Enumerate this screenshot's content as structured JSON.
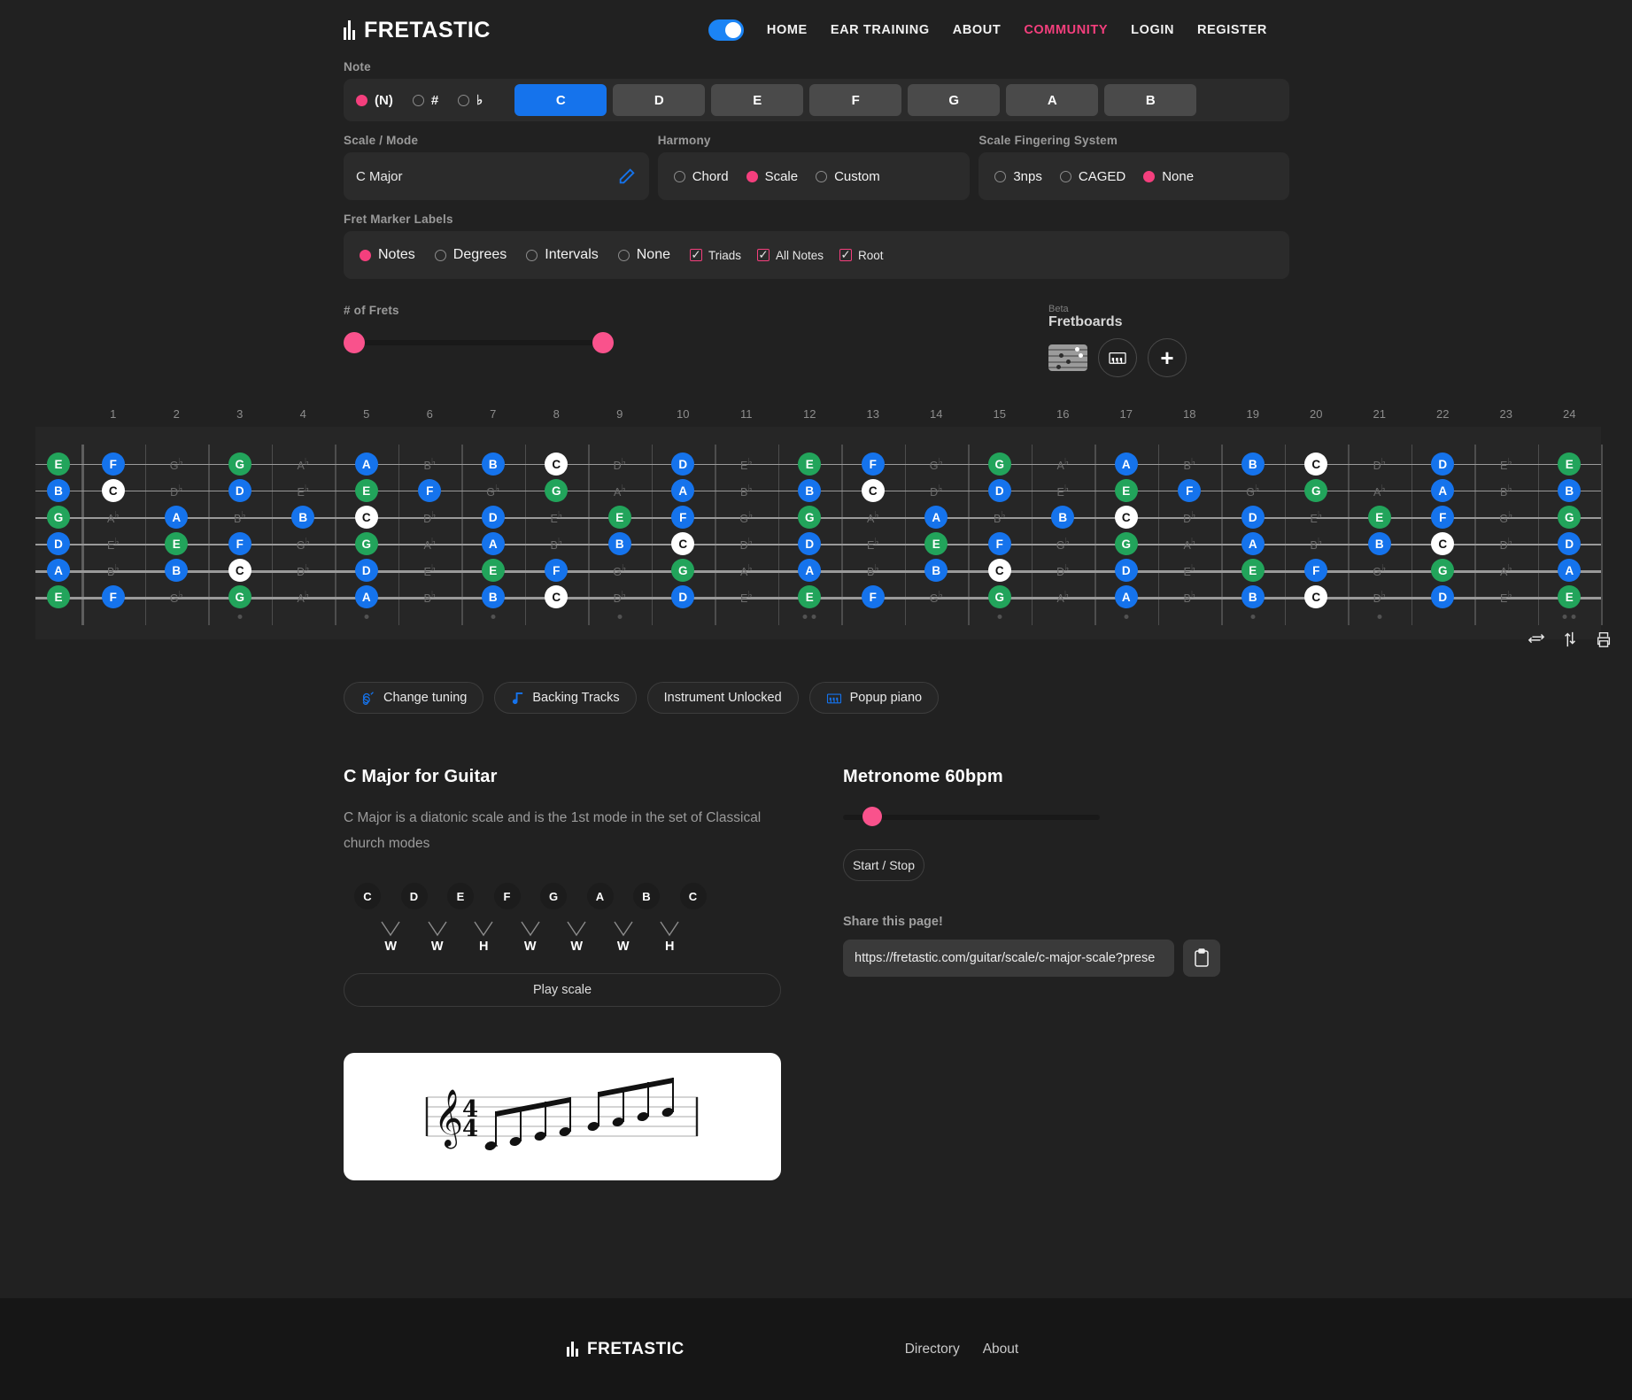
{
  "header": {
    "brand": "FRETASTIC",
    "toggle_state": "on",
    "nav": [
      {
        "label": "HOME",
        "active": false
      },
      {
        "label": "EAR TRAINING",
        "active": false
      },
      {
        "label": "ABOUT",
        "active": false
      },
      {
        "label": "COMMUNITY",
        "active": true
      },
      {
        "label": "LOGIN",
        "active": false
      },
      {
        "label": "REGISTER",
        "active": false
      }
    ]
  },
  "note_section": {
    "label": "Note",
    "accidentals": [
      {
        "label": "(N)",
        "selected": true
      },
      {
        "label": "#",
        "selected": false
      },
      {
        "label": "♭",
        "selected": false
      }
    ],
    "notes": [
      {
        "label": "C",
        "selected": true
      },
      {
        "label": "D",
        "selected": false
      },
      {
        "label": "E",
        "selected": false
      },
      {
        "label": "F",
        "selected": false
      },
      {
        "label": "G",
        "selected": false
      },
      {
        "label": "A",
        "selected": false
      },
      {
        "label": "B",
        "selected": false
      }
    ]
  },
  "scale_mode": {
    "label": "Scale / Mode",
    "value": "C Major",
    "edit_icon": "pencil-icon"
  },
  "harmony": {
    "label": "Harmony",
    "options": [
      {
        "label": "Chord",
        "selected": false
      },
      {
        "label": "Scale",
        "selected": true
      },
      {
        "label": "Custom",
        "selected": false
      }
    ]
  },
  "fingering": {
    "label": "Scale Fingering System",
    "options": [
      {
        "label": "3nps",
        "selected": false
      },
      {
        "label": "CAGED",
        "selected": false
      },
      {
        "label": "None",
        "selected": true
      }
    ]
  },
  "fret_marker_labels": {
    "label": "Fret Marker Labels",
    "radios": [
      {
        "label": "Notes",
        "selected": true
      },
      {
        "label": "Degrees",
        "selected": false
      },
      {
        "label": "Intervals",
        "selected": false
      },
      {
        "label": "None",
        "selected": false
      }
    ],
    "checkboxes": [
      {
        "label": "Triads",
        "checked": true
      },
      {
        "label": "All Notes",
        "checked": true
      },
      {
        "label": "Root",
        "checked": true
      }
    ]
  },
  "frets_slider": {
    "label": "# of Frets",
    "min_value": 0,
    "max_value": 24
  },
  "fretboards": {
    "beta": "Beta",
    "title": "Fretboards",
    "items": [
      "fretboard-thumb-icon",
      "piano-icon",
      "plus-icon"
    ]
  },
  "fretboard": {
    "fret_numbers": [
      1,
      2,
      3,
      4,
      5,
      6,
      7,
      8,
      9,
      10,
      11,
      12,
      13,
      14,
      15,
      16,
      17,
      18,
      19,
      20,
      21,
      22,
      23,
      24
    ],
    "open_strings": [
      "E",
      "B",
      "G",
      "D",
      "A",
      "E"
    ],
    "inlay_frets": [
      3,
      5,
      7,
      9,
      12,
      15,
      17,
      19,
      21,
      24
    ],
    "root_note": "C",
    "scale_notes": [
      "C",
      "D",
      "E",
      "F",
      "G",
      "A",
      "B"
    ],
    "color_legend": {
      "root": "#ffffff",
      "triad": "#22a45b",
      "scale": "#1573ec",
      "non_scale": "#6b6b6b"
    },
    "strings": [
      {
        "open": "E",
        "notes": [
          "F",
          "G♭",
          "G",
          "A♭",
          "A",
          "B♭",
          "B",
          "C",
          "D♭",
          "D",
          "E♭",
          "E",
          "F",
          "G♭",
          "G",
          "A♭",
          "A",
          "B♭",
          "B",
          "C",
          "D♭",
          "D",
          "E♭",
          "E"
        ]
      },
      {
        "open": "B",
        "notes": [
          "C",
          "D♭",
          "D",
          "E♭",
          "E",
          "F",
          "G♭",
          "G",
          "A♭",
          "A",
          "B♭",
          "B",
          "C",
          "D♭",
          "D",
          "E♭",
          "E",
          "F",
          "G♭",
          "G",
          "A♭",
          "A",
          "B♭",
          "B"
        ]
      },
      {
        "open": "G",
        "notes": [
          "A♭",
          "A",
          "B♭",
          "B",
          "C",
          "D♭",
          "D",
          "E♭",
          "E",
          "F",
          "G♭",
          "G",
          "A♭",
          "A",
          "B♭",
          "B",
          "C",
          "D♭",
          "D",
          "E♭",
          "E",
          "F",
          "G♭",
          "G"
        ]
      },
      {
        "open": "D",
        "notes": [
          "E♭",
          "E",
          "F",
          "G♭",
          "G",
          "A♭",
          "A",
          "B♭",
          "B",
          "C",
          "D♭",
          "D",
          "E♭",
          "E",
          "F",
          "G♭",
          "G",
          "A♭",
          "A",
          "B♭",
          "B",
          "C",
          "D♭",
          "D"
        ]
      },
      {
        "open": "A",
        "notes": [
          "B♭",
          "B",
          "C",
          "D♭",
          "D",
          "E♭",
          "E",
          "F",
          "G♭",
          "G",
          "A♭",
          "A",
          "B♭",
          "B",
          "C",
          "D♭",
          "D",
          "E♭",
          "E",
          "F",
          "G♭",
          "G",
          "A♭",
          "A"
        ]
      },
      {
        "open": "E",
        "notes": [
          "F",
          "G♭",
          "G",
          "A♭",
          "A",
          "B♭",
          "B",
          "C",
          "D♭",
          "D",
          "E♭",
          "E",
          "F",
          "G♭",
          "G",
          "A♭",
          "A",
          "B♭",
          "B",
          "C",
          "D♭",
          "D",
          "E♭",
          "E"
        ]
      }
    ],
    "tools": [
      "flip-horizontal-icon",
      "flip-vertical-icon",
      "print-icon"
    ]
  },
  "chips": [
    {
      "label": "Change tuning",
      "icon": "guitar-icon"
    },
    {
      "label": "Backing Tracks",
      "icon": "music-note-icon"
    },
    {
      "label": "Instrument Unlocked",
      "icon": ""
    },
    {
      "label": "Popup piano",
      "icon": "piano-icon"
    }
  ],
  "scale_info": {
    "title": "C Major for Guitar",
    "description": "C Major is a diatonic scale and is the 1st mode in the set of Classical church modes",
    "notes": [
      "C",
      "D",
      "E",
      "F",
      "G",
      "A",
      "B",
      "C"
    ],
    "steps": [
      "W",
      "W",
      "H",
      "W",
      "W",
      "W",
      "H"
    ],
    "play_label": "Play scale"
  },
  "notation": {
    "clef": "treble",
    "time_signature": "4/4",
    "notes": [
      "C",
      "D",
      "E",
      "F",
      "G",
      "A",
      "B",
      "C"
    ]
  },
  "metronome": {
    "title": "Metronome 60bpm",
    "bpm": 60,
    "start_stop_label": "Start / Stop"
  },
  "share": {
    "label": "Share this page!",
    "url": "https://fretastic.com/guitar/scale/c-major-scale?prese",
    "copy_icon": "clipboard-icon"
  },
  "footer": {
    "brand": "FRETASTIC",
    "links": [
      {
        "label": "Directory"
      },
      {
        "label": "About"
      }
    ]
  }
}
